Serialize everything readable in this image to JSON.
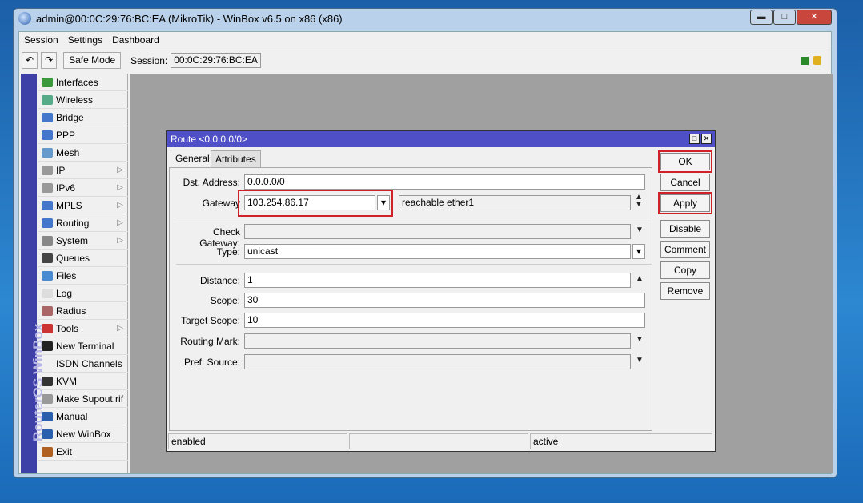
{
  "window": {
    "title": "admin@00:0C:29:76:BC:EA (MikroTik) - WinBox v6.5 on x86 (x86)",
    "minimize": "▬",
    "maximize": "□",
    "close": "✕"
  },
  "menu": [
    "Session",
    "Settings",
    "Dashboard"
  ],
  "toolbar": {
    "undo": "↶",
    "redo": "↷",
    "safe_mode": "Safe Mode",
    "session_label": "Session:",
    "session_value": "00:0C:29:76:BC:EA"
  },
  "sidebar": {
    "brand": "RouterOS WinBox",
    "items": [
      {
        "label": "Interfaces",
        "color": "#3c9a3c",
        "sub": false
      },
      {
        "label": "Wireless",
        "color": "#5a8",
        "sub": false
      },
      {
        "label": "Bridge",
        "color": "#4477cc",
        "sub": false
      },
      {
        "label": "PPP",
        "color": "#4477cc",
        "sub": false
      },
      {
        "label": "Mesh",
        "color": "#6699cc",
        "sub": false
      },
      {
        "label": "IP",
        "color": "#999",
        "sub": true
      },
      {
        "label": "IPv6",
        "color": "#999",
        "sub": true
      },
      {
        "label": "MPLS",
        "color": "#4477cc",
        "sub": true
      },
      {
        "label": "Routing",
        "color": "#4477cc",
        "sub": true
      },
      {
        "label": "System",
        "color": "#888",
        "sub": true
      },
      {
        "label": "Queues",
        "color": "#444",
        "sub": false
      },
      {
        "label": "Files",
        "color": "#4a8ad0",
        "sub": false
      },
      {
        "label": "Log",
        "color": "#ddd",
        "sub": false
      },
      {
        "label": "Radius",
        "color": "#a66",
        "sub": false
      },
      {
        "label": "Tools",
        "color": "#c33",
        "sub": true
      },
      {
        "label": "New Terminal",
        "color": "#222",
        "sub": false
      },
      {
        "label": "ISDN Channels",
        "color": "transparent",
        "sub": false
      },
      {
        "label": "KVM",
        "color": "#333",
        "sub": false
      },
      {
        "label": "Make Supout.rif",
        "color": "#999",
        "sub": false
      },
      {
        "label": "Manual",
        "color": "#2a5fae",
        "sub": false
      },
      {
        "label": "New WinBox",
        "color": "#2a5fae",
        "sub": false
      },
      {
        "label": "Exit",
        "color": "#b06020",
        "sub": false
      }
    ]
  },
  "dialog": {
    "title": "Route <0.0.0.0/0>",
    "tabs": [
      "General",
      "Attributes"
    ],
    "fields": {
      "dst_label": "Dst. Address:",
      "dst": "0.0.0.0/0",
      "gw_label": "Gateway",
      "gw": "103.254.86.17",
      "gw_status": "reachable ether1",
      "check_label": "Check Gateway:",
      "check": "",
      "type_label": "Type:",
      "type": "unicast",
      "distance_label": "Distance:",
      "distance": "1",
      "scope_label": "Scope:",
      "scope": "30",
      "target_label": "Target Scope:",
      "target": "10",
      "mark_label": "Routing Mark:",
      "mark": "",
      "pref_label": "Pref. Source:",
      "pref": ""
    },
    "buttons": [
      "OK",
      "Cancel",
      "Apply",
      "Disable",
      "Comment",
      "Copy",
      "Remove"
    ],
    "status": [
      "enabled",
      "",
      "active"
    ]
  },
  "colors": {
    "highlight": "#d0202a",
    "dialog_title": "#4f50c8"
  }
}
